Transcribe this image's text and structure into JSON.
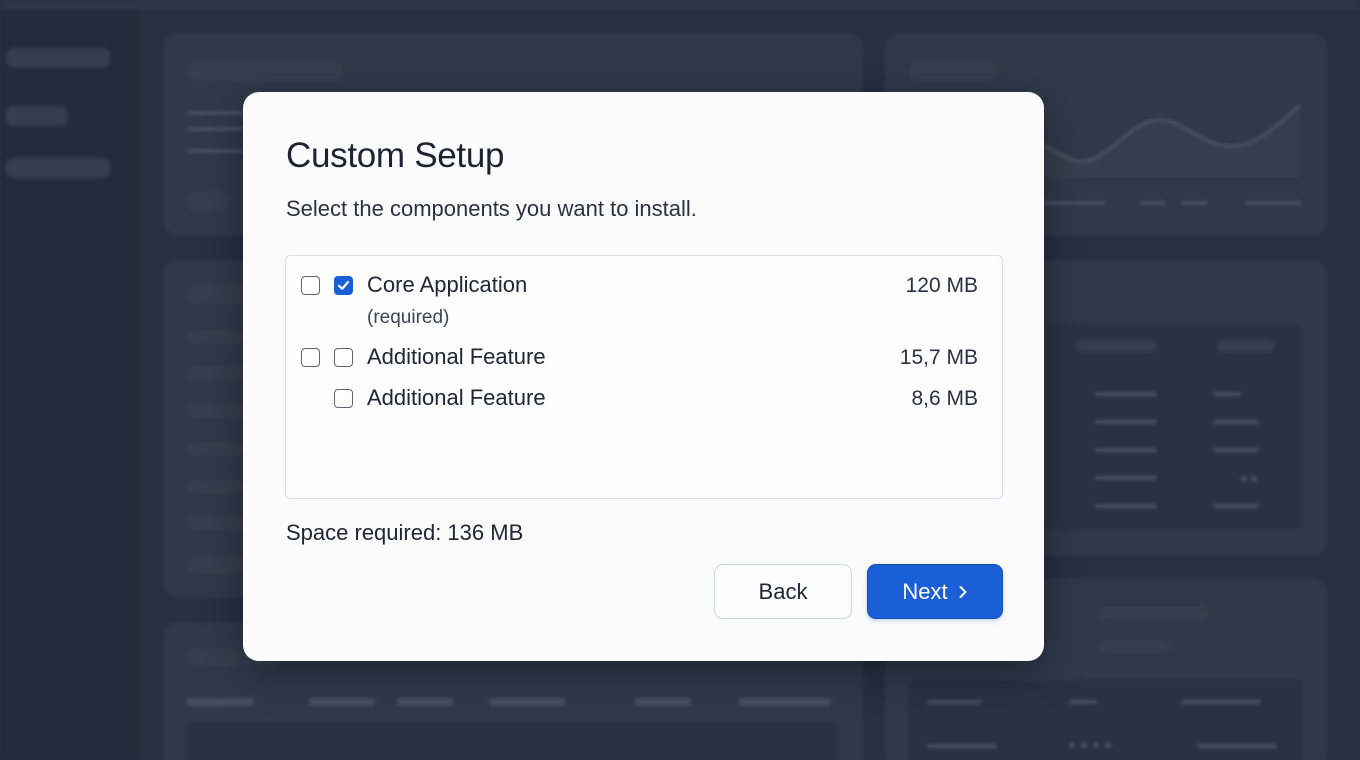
{
  "dialog": {
    "title": "Custom Setup",
    "subtitle": "Select the components you want to install.",
    "components": [
      {
        "label": "Core Application",
        "note": "(required)",
        "size": "120 MB",
        "selected": true
      },
      {
        "label": "Additional Feature",
        "size": "15,7 MB",
        "selected": false
      },
      {
        "label": "Additional Feature",
        "size": "8,6 MB",
        "selected": false
      }
    ],
    "space_required": "Space required: 136 MB",
    "back_label": "Back",
    "next_label": "Next"
  },
  "icons": {
    "check": "checkmark-icon",
    "next": "chevron-right-icon"
  },
  "colors": {
    "accent": "#1a5fd6",
    "backdrop": "#253041",
    "dialog_bg": "#fbfbfc"
  }
}
